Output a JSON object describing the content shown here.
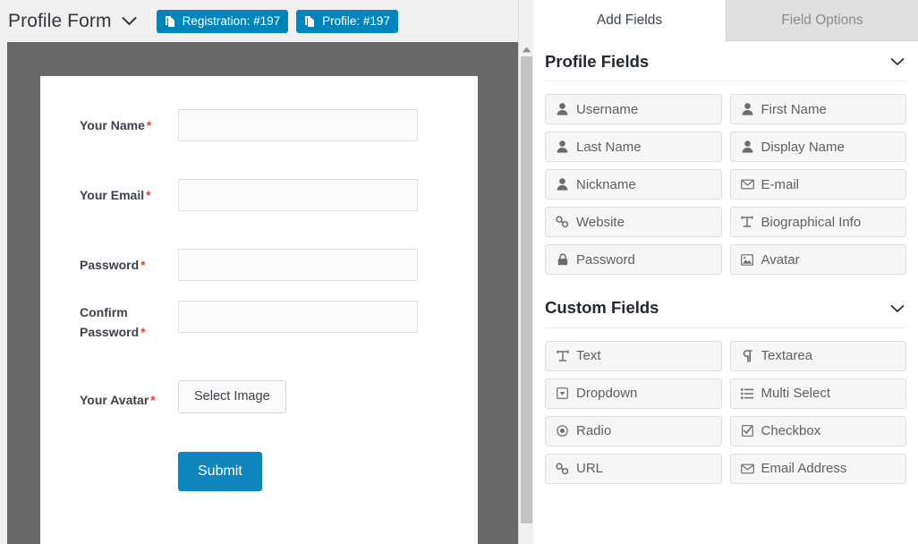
{
  "toolbar": {
    "form_title": "Profile Form",
    "caret_icon": "chevron-down-icon",
    "buttons": [
      {
        "label": "Registration: #197",
        "icon": "copy-page-icon",
        "color": "#0085ba"
      },
      {
        "label": "Profile: #197",
        "icon": "copy-page-icon",
        "color": "#0085ba"
      }
    ]
  },
  "preview": {
    "stage_color": "#686868",
    "card_color": "#ffffff",
    "required_marker": "*",
    "required_color": "#e8412a",
    "rows": [
      {
        "label": "Your Name",
        "required": true,
        "control": "input",
        "value": ""
      },
      {
        "label": "Your Email",
        "required": true,
        "control": "input",
        "value": ""
      },
      {
        "label": "Password",
        "required": true,
        "control": "input",
        "value": ""
      },
      {
        "label": "Confirm Password",
        "required": true,
        "control": "input",
        "value": ""
      },
      {
        "label": "Your Avatar",
        "required": true,
        "control": "button",
        "value": "Select Image"
      }
    ],
    "labels": {
      "name": "Your Name",
      "email": "Your Email",
      "password": "Password",
      "confirm_password_line1": "Confirm",
      "confirm_password_line2": "Password",
      "avatar": "Your Avatar"
    },
    "select_image_label": "Select Image",
    "submit_label": "Submit",
    "submit_color": "#0e85bd"
  },
  "scrollbar": {
    "up_arrow_icon": "triangle-up-icon",
    "thumb_color": "#c2c2c2"
  },
  "right_panel": {
    "tabs": [
      {
        "label": "Add Fields",
        "active": true
      },
      {
        "label": "Field Options",
        "active": false
      }
    ],
    "sections": [
      {
        "title": "Profile Fields",
        "caret_icon": "chevron-down-icon",
        "fields": [
          {
            "label": "Username",
            "icon": "user-icon"
          },
          {
            "label": "First Name",
            "icon": "user-icon"
          },
          {
            "label": "Last Name",
            "icon": "user-icon"
          },
          {
            "label": "Display Name",
            "icon": "user-icon"
          },
          {
            "label": "Nickname",
            "icon": "user-icon"
          },
          {
            "label": "E-mail",
            "icon": "envelope-icon"
          },
          {
            "label": "Website",
            "icon": "link-icon"
          },
          {
            "label": "Biographical Info",
            "icon": "text-height-icon"
          },
          {
            "label": "Password",
            "icon": "lock-icon"
          },
          {
            "label": "Avatar",
            "icon": "image-icon"
          }
        ]
      },
      {
        "title": "Custom Fields",
        "caret_icon": "chevron-down-icon",
        "fields": [
          {
            "label": "Text",
            "icon": "text-height-icon"
          },
          {
            "label": "Textarea",
            "icon": "paragraph-icon"
          },
          {
            "label": "Dropdown",
            "icon": "caret-square-down-icon"
          },
          {
            "label": "Multi Select",
            "icon": "list-icon"
          },
          {
            "label": "Radio",
            "icon": "radio-icon"
          },
          {
            "label": "Checkbox",
            "icon": "check-square-icon"
          },
          {
            "label": "URL",
            "icon": "link-icon"
          },
          {
            "label": "Email Address",
            "icon": "envelope-icon"
          }
        ]
      }
    ]
  }
}
